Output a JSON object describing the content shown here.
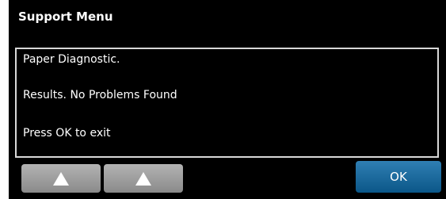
{
  "window": {
    "title": "Support Menu"
  },
  "message": {
    "lines": [
      "Paper Diagnostic.",
      "Results. No Problems Found",
      "Press OK to exit"
    ]
  },
  "buttons": {
    "up_1_icon": "up-arrow-icon",
    "up_2_icon": "up-arrow-icon",
    "ok_label": "OK"
  },
  "colors": {
    "background": "#000000",
    "text": "#ffffff",
    "border": "#d8d8d8",
    "up_button": "#9f9f9f",
    "ok_button": "#1c6c9e"
  }
}
